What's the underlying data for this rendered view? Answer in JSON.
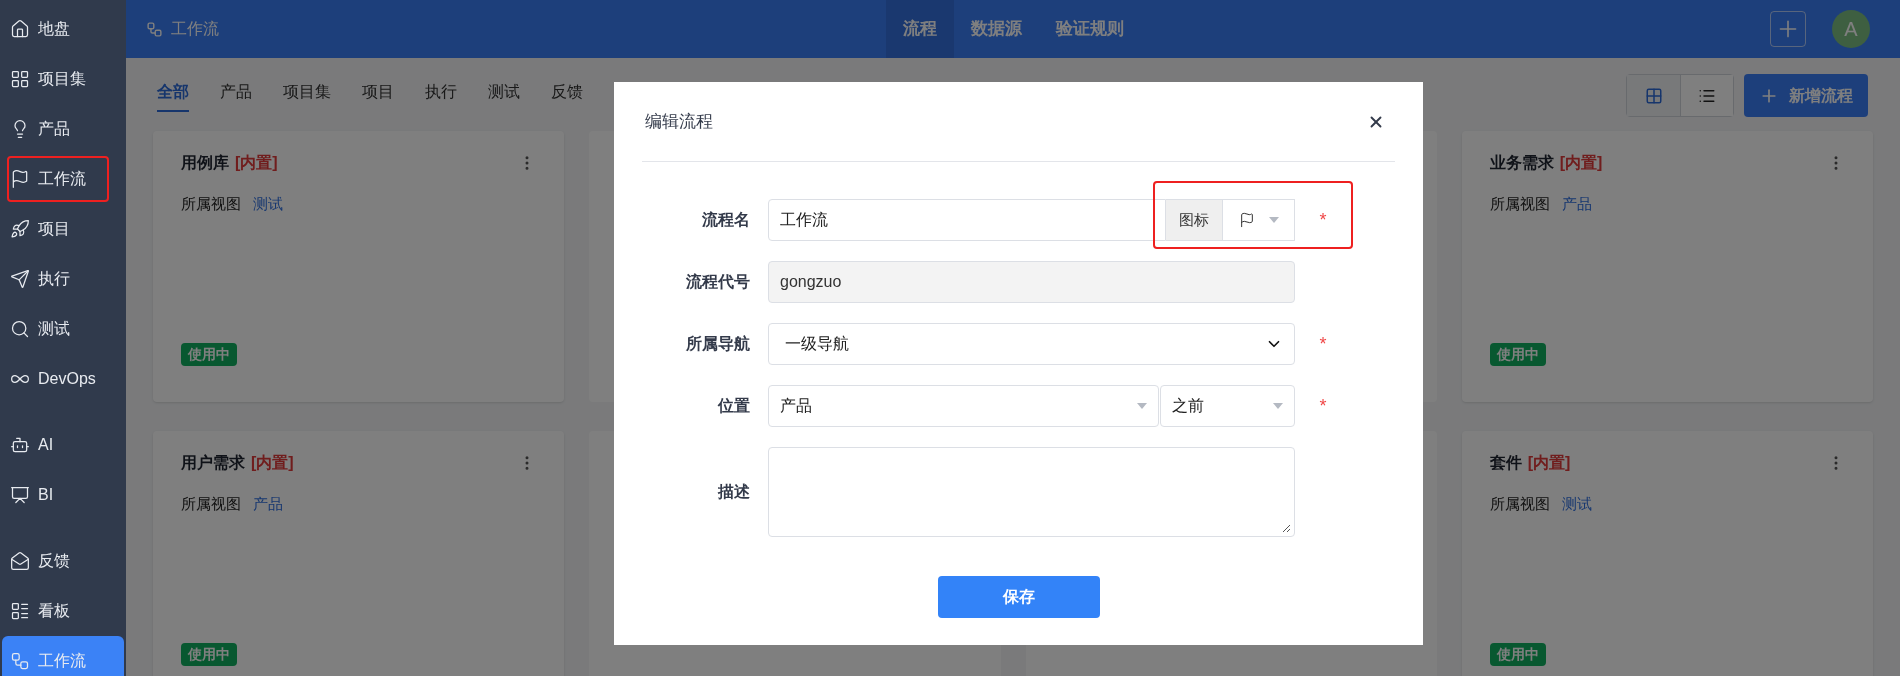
{
  "sidebar": {
    "items": [
      {
        "kind": "item",
        "label": "地盘",
        "selected": false,
        "annotated": false
      },
      {
        "kind": "item",
        "label": "项目集",
        "selected": false,
        "annotated": false
      },
      {
        "kind": "item",
        "label": "产品",
        "selected": false,
        "annotated": false
      },
      {
        "kind": "item",
        "label": "工作流",
        "selected": false,
        "annotated": true
      },
      {
        "kind": "item",
        "label": "项目",
        "selected": false,
        "annotated": false
      },
      {
        "kind": "item",
        "label": "执行",
        "selected": false,
        "annotated": false
      },
      {
        "kind": "item",
        "label": "测试",
        "selected": false,
        "annotated": false
      },
      {
        "kind": "item",
        "label": "DevOps",
        "selected": false,
        "annotated": false
      },
      {
        "kind": "divider"
      },
      {
        "kind": "item",
        "label": "AI",
        "selected": false,
        "annotated": false
      },
      {
        "kind": "item",
        "label": "BI",
        "selected": false,
        "annotated": false
      },
      {
        "kind": "divider"
      },
      {
        "kind": "item",
        "label": "反馈",
        "selected": false,
        "annotated": false
      },
      {
        "kind": "item",
        "label": "看板",
        "selected": false,
        "annotated": false
      },
      {
        "kind": "item",
        "label": "工作流",
        "selected": true,
        "annotated": false
      }
    ]
  },
  "top_bar": {
    "title": "工作流",
    "nav": [
      {
        "label": "流程",
        "selected": true
      },
      {
        "label": "数据源",
        "selected": false
      },
      {
        "label": "验证规则",
        "selected": false
      }
    ],
    "avatar": "A"
  },
  "tabs": [
    {
      "label": "全部",
      "selected": true
    },
    {
      "label": "产品",
      "selected": false
    },
    {
      "label": "项目集",
      "selected": false
    },
    {
      "label": "项目",
      "selected": false
    },
    {
      "label": "执行",
      "selected": false
    },
    {
      "label": "测试",
      "selected": false
    },
    {
      "label": "反馈",
      "selected": false
    }
  ],
  "view_toggle": [
    {
      "kind": "grid",
      "selected": true
    },
    {
      "kind": "list",
      "selected": false
    }
  ],
  "add_button": "新增流程",
  "cards": [
    {
      "kind": "full",
      "title": "用例库",
      "tag": "[内置]",
      "view_label": "所属视图",
      "view": "测试",
      "status": "使用中"
    },
    {
      "kind": "covered"
    },
    {
      "kind": "covered"
    },
    {
      "kind": "full",
      "title": "业务需求",
      "tag": "[内置]",
      "view_label": "所属视图",
      "view": "产品",
      "status": "使用中"
    },
    {
      "kind": "full",
      "title": "用户需求",
      "tag": "[内置]",
      "view_label": "所属视图",
      "view": "产品",
      "status": "使用中"
    },
    {
      "kind": "covered"
    },
    {
      "kind": "covered"
    },
    {
      "kind": "full",
      "title": "套件",
      "tag": "[内置]",
      "view_label": "所属视图",
      "view": "测试",
      "status": "使用中"
    }
  ],
  "dialog": {
    "title": "编辑流程",
    "fields": [
      {
        "kind": "text_with_icon",
        "label": "流程名",
        "value": "工作流",
        "addon": "图标",
        "required_mark": "*",
        "annotated": true
      },
      {
        "kind": "disabled",
        "label": "流程代号",
        "value": "gongzuo",
        "annotated": false
      },
      {
        "kind": "select",
        "label": "所属导航",
        "value": "一级导航",
        "required_mark": "*",
        "annotated": false
      },
      {
        "kind": "pair",
        "label": "位置",
        "value": "产品",
        "value_2": "之前",
        "required_mark": "*",
        "annotated": false
      },
      {
        "kind": "textarea",
        "label": "描述",
        "annotated": false
      }
    ],
    "save_button": "保存"
  }
}
